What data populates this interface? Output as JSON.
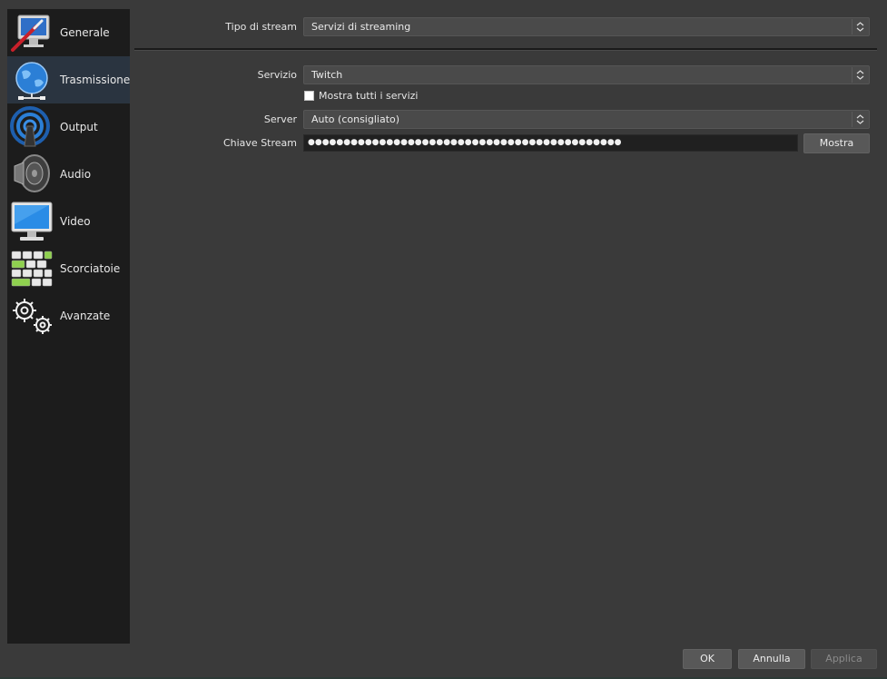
{
  "sidebar": {
    "items": [
      {
        "label": "Generale",
        "icon": "general-settings-icon"
      },
      {
        "label": "Trasmissione",
        "icon": "globe-network-icon"
      },
      {
        "label": "Output",
        "icon": "broadcast-antenna-icon"
      },
      {
        "label": "Audio",
        "icon": "speaker-icon"
      },
      {
        "label": "Video",
        "icon": "monitor-icon"
      },
      {
        "label": "Scorciatoie",
        "icon": "keyboard-icon"
      },
      {
        "label": "Avanzate",
        "icon": "gears-icon"
      }
    ],
    "active_index": 1
  },
  "stream": {
    "type_label": "Tipo di stream",
    "type_value": "Servizi di streaming",
    "service_label": "Servizio",
    "service_value": "Twitch",
    "show_all_label": "Mostra tutti i servizi",
    "show_all_checked": false,
    "server_label": "Server",
    "server_value": "Auto (consigliato)",
    "key_label": "Chiave Stream",
    "key_masked": "●●●●●●●●●●●●●●●●●●●●●●●●●●●●●●●●●●●●●●●●●●●●",
    "show_button": "Mostra"
  },
  "footer": {
    "ok": "OK",
    "cancel": "Annulla",
    "apply": "Applica"
  }
}
